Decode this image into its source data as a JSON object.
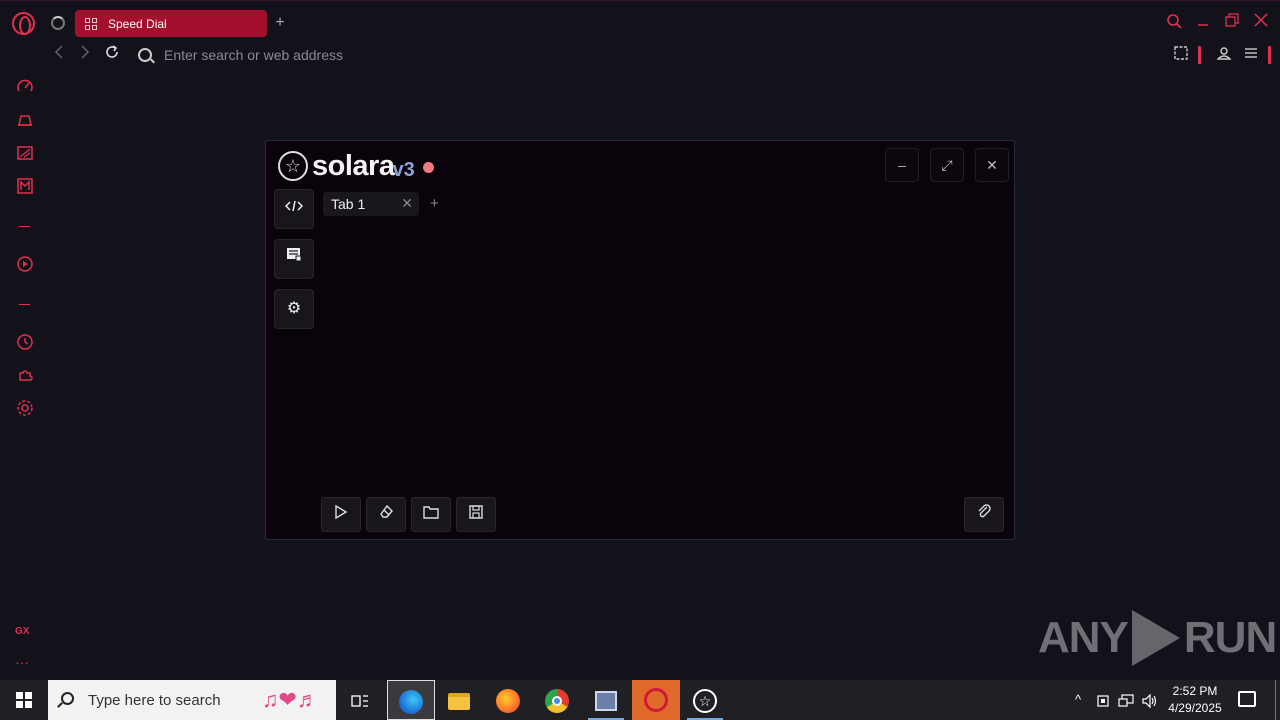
{
  "browser": {
    "tab": {
      "title": "Speed Dial"
    },
    "new_tab": "+",
    "address_placeholder": "Enter search or web address"
  },
  "sidebar": {
    "gx_label": "GX",
    "more": "···"
  },
  "solara": {
    "name": "solara",
    "version": "v3",
    "tabs": [
      {
        "label": "Tab 1"
      }
    ],
    "add_tab": "+",
    "status_color": "#f07a7e"
  },
  "watermark": {
    "left": "ANY",
    "right": "RUN"
  },
  "taskbar": {
    "search_placeholder": "Type here to search",
    "time": "2:52 PM",
    "date": "4/29/2025"
  },
  "colors": {
    "accent": "#e0304f",
    "tab_active": "#a3102e",
    "window_bg": "#0b030b"
  }
}
